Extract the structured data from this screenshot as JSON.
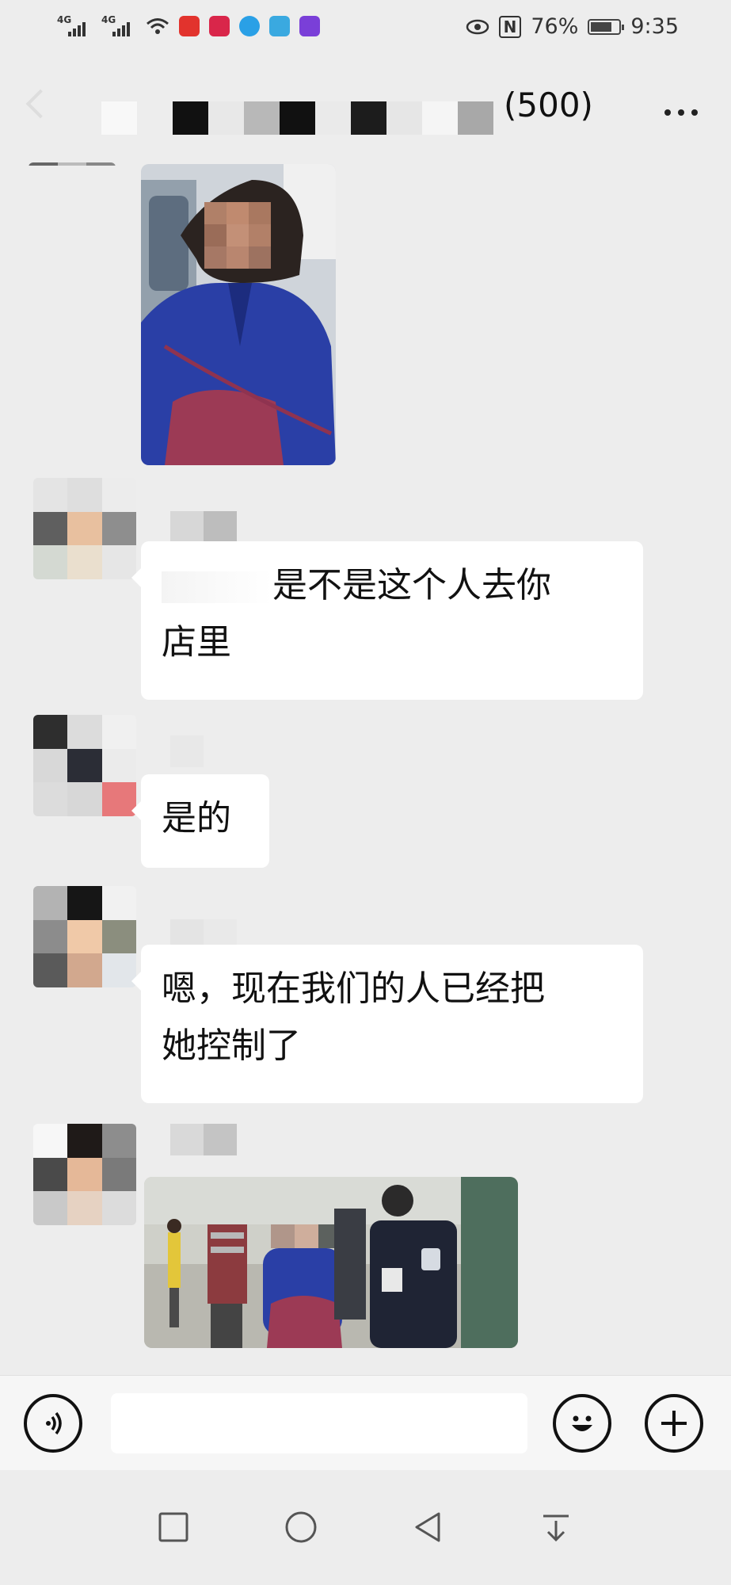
{
  "status_bar": {
    "network_1": "4G",
    "network_2": "4G",
    "battery_percent": "76%",
    "battery_level": 0.76,
    "time": "9:35",
    "nfc_label": "N"
  },
  "header": {
    "group_member_count": "(500)"
  },
  "messages": [
    {
      "type": "image",
      "description_icon": "photo-woman-on-bus"
    },
    {
      "type": "text",
      "line1": "是不是这个人去你",
      "line2": "店里"
    },
    {
      "type": "text",
      "line1": "是的"
    },
    {
      "type": "text",
      "line1": "嗯，现在我们的人已经把",
      "line2": "她控制了"
    },
    {
      "type": "image",
      "description_icon": "photo-police-detaining-woman"
    }
  ],
  "colors": {
    "background": "#ededed",
    "bubble": "#ffffff",
    "shirt_blue": "#2a3fa6"
  },
  "nav": {
    "recents_icon": "square-icon",
    "home_icon": "circle-icon",
    "back_icon": "triangle-back-icon",
    "notification_icon": "pull-down-icon"
  }
}
